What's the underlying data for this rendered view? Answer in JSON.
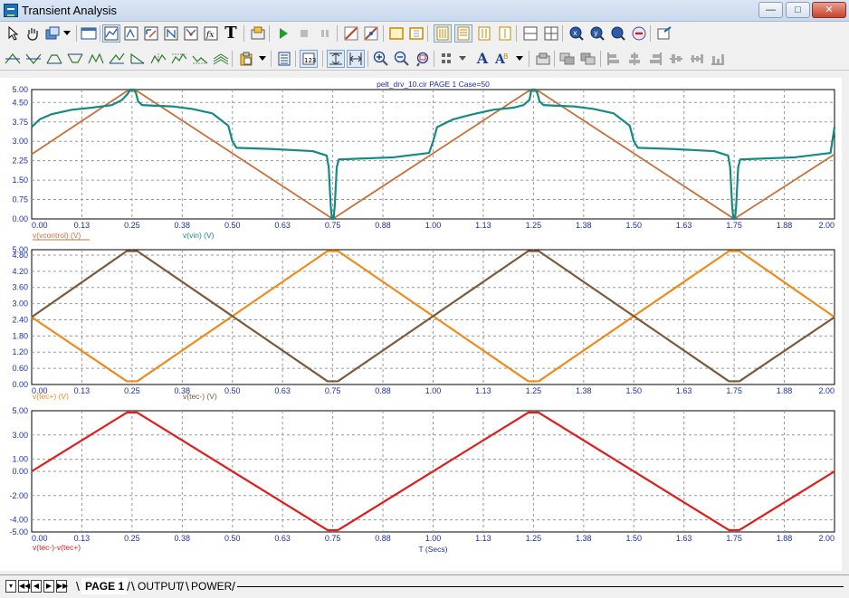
{
  "window": {
    "title": "Transient Analysis",
    "minimize_label": "—",
    "maximize_label": "□",
    "close_label": "✕"
  },
  "toolbar1": {
    "icons": [
      "select-arrow-icon",
      "pan-hand-icon",
      "properties-icon",
      "dropdown-arrow-icon",
      "window-icon",
      "graph-icon",
      "graph-scale-icon",
      "graph-zoom-icon",
      "graph-auto-icon",
      "graph-point-icon",
      "function-icon",
      "text-T-icon",
      "dialog-icon",
      "run-icon",
      "stop-icon",
      "pause-icon",
      "cursor-left-icon",
      "cursor-right-icon",
      "frame-icon",
      "frame-grid-icon",
      "page-layout-a-icon",
      "page-layout-b-icon",
      "page-layout-c-icon",
      "page-layout-d-icon",
      "split-horizontal-icon",
      "split-grid-icon",
      "search-x-icon",
      "search-y-icon",
      "search-fx-icon",
      "stop-circle-icon",
      "properties-check-icon"
    ]
  },
  "toolbar2": {
    "icons": [
      "peak-icon",
      "valley-icon",
      "high-icon",
      "low-icon",
      "inflection-icon",
      "slope-icon",
      "global-high-icon",
      "global-low-icon",
      "top-icon",
      "bottom-icon",
      "clipboard-icon",
      "dropdown-arrow-icon",
      "list-icon",
      "tokens-icon",
      "data-points-icon",
      "fit-icon",
      "zoom-in-icon",
      "zoom-out-icon",
      "zoom-window-icon",
      "grid-dots-icon",
      "font-A-icon",
      "font-AB-icon",
      "label-icon",
      "overlap-icon",
      "stack-icon",
      "align-left-icon",
      "align-center-icon",
      "align-right-icon",
      "align-top-icon",
      "align-bottom-icon"
    ],
    "fx_label": "fx",
    "t_label": "T",
    "a_label": "A"
  },
  "tabs": [
    {
      "label": "PAGE 1",
      "active": true
    },
    {
      "label": "OUTPUT",
      "active": false
    },
    {
      "label": "POWER",
      "active": false
    }
  ],
  "nav_buttons": [
    "▾",
    "◀◀",
    "◀",
    "▶",
    "▶▶"
  ],
  "chart_data": [
    {
      "type": "line",
      "title": "pelt_drv_10.cir PAGE 1 Case=50",
      "xlabel": "",
      "ylabel": "",
      "xlim": [
        0,
        2
      ],
      "ylim": [
        0,
        5
      ],
      "x_ticks": [
        "0.00",
        "0.13",
        "0.25",
        "0.38",
        "0.50",
        "0.63",
        "0.75",
        "0.88",
        "1.00",
        "1.13",
        "1.25",
        "1.38",
        "1.50",
        "1.63",
        "1.75",
        "1.88",
        "2.00"
      ],
      "y_ticks": [
        "0.00",
        "0.75",
        "1.50",
        "2.25",
        "3.00",
        "3.75",
        "4.50",
        "5.00"
      ],
      "grid": true,
      "series": [
        {
          "name": "v(vcontrol) (V)",
          "color": "#c8703a",
          "x": [
            0,
            0.237,
            0.263,
            0.75,
            1.237,
            1.263,
            1.75,
            2.0
          ],
          "y": [
            2.5,
            4.94,
            4.94,
            0.0,
            4.94,
            4.94,
            0.0,
            2.5
          ]
        },
        {
          "name": "v(vin) (V)",
          "color": "#158a84",
          "x": [
            0,
            0.02,
            0.05,
            0.1,
            0.15,
            0.2,
            0.225,
            0.24,
            0.245,
            0.25,
            0.255,
            0.26,
            0.265,
            0.275,
            0.3,
            0.35,
            0.4,
            0.45,
            0.49,
            0.5,
            0.51,
            0.6,
            0.7,
            0.735,
            0.74,
            0.745,
            0.748,
            0.752,
            0.755,
            0.76,
            0.765,
            0.8,
            0.9,
            0.99,
            1.0,
            1.01,
            1.05,
            1.1,
            1.15,
            1.2,
            1.225,
            1.24,
            1.245,
            1.25,
            1.255,
            1.26,
            1.265,
            1.275,
            1.3,
            1.35,
            1.4,
            1.45,
            1.49,
            1.5,
            1.51,
            1.6,
            1.7,
            1.735,
            1.74,
            1.745,
            1.748,
            1.752,
            1.755,
            1.76,
            1.765,
            1.8,
            1.9,
            1.99,
            2.0
          ],
          "y": [
            3.55,
            3.85,
            4.05,
            4.22,
            4.3,
            4.4,
            4.6,
            4.85,
            5.0,
            5.0,
            5.0,
            4.85,
            4.55,
            4.4,
            4.38,
            4.35,
            4.25,
            4.08,
            3.6,
            3.0,
            2.75,
            2.7,
            2.62,
            2.45,
            2.0,
            0.5,
            0.0,
            0.0,
            0.5,
            2.0,
            2.3,
            2.32,
            2.38,
            2.55,
            3.0,
            3.55,
            3.85,
            4.05,
            4.22,
            4.3,
            4.4,
            4.6,
            5.0,
            5.0,
            5.0,
            4.85,
            4.55,
            4.4,
            4.38,
            4.35,
            4.25,
            4.08,
            3.6,
            3.0,
            2.75,
            2.7,
            2.62,
            2.45,
            2.0,
            0.5,
            0.0,
            0.0,
            0.5,
            2.0,
            2.3,
            2.32,
            2.38,
            2.55,
            3.55
          ]
        }
      ]
    },
    {
      "type": "line",
      "title": "",
      "xlabel": "",
      "ylabel": "",
      "xlim": [
        0,
        2
      ],
      "ylim": [
        0,
        5
      ],
      "x_ticks": [
        "0.00",
        "0.13",
        "0.25",
        "0.38",
        "0.50",
        "0.63",
        "0.75",
        "0.88",
        "1.00",
        "1.13",
        "1.25",
        "1.38",
        "1.50",
        "1.63",
        "1.75",
        "1.88",
        "2.00"
      ],
      "y_ticks": [
        "0.00",
        "0.60",
        "1.20",
        "1.80",
        "2.40",
        "3.00",
        "3.60",
        "4.20",
        "4.80",
        "5.00"
      ],
      "grid": true,
      "series": [
        {
          "name": "v(tec+) (V)",
          "color": "#f08a1a",
          "x": [
            0,
            0.237,
            0.263,
            0.737,
            0.763,
            1.237,
            1.263,
            1.737,
            1.763,
            2.0
          ],
          "y": [
            2.5,
            0.12,
            0.12,
            4.95,
            4.95,
            0.12,
            0.12,
            4.95,
            4.95,
            2.5
          ]
        },
        {
          "name": "v(tec-) (V)",
          "color": "#7b5a3c",
          "x": [
            0,
            0.237,
            0.263,
            0.737,
            0.763,
            1.237,
            1.263,
            1.737,
            1.763,
            2.0
          ],
          "y": [
            2.5,
            4.95,
            4.95,
            0.12,
            0.12,
            4.95,
            4.95,
            0.12,
            0.12,
            2.5
          ]
        }
      ]
    },
    {
      "type": "line",
      "title": "",
      "xlabel": "T (Secs)",
      "ylabel": "",
      "xlim": [
        0,
        2
      ],
      "ylim": [
        -5,
        5
      ],
      "x_ticks": [
        "0.00",
        "0.13",
        "0.25",
        "0.38",
        "0.50",
        "0.63",
        "0.75",
        "0.88",
        "1.00",
        "1.13",
        "1.25",
        "1.38",
        "1.50",
        "1.63",
        "1.75",
        "1.88",
        "2.00"
      ],
      "y_ticks": [
        "-5.00",
        "-4.00",
        "-2.00",
        "0.00",
        "1.00",
        "3.00",
        "5.00"
      ],
      "grid": true,
      "series": [
        {
          "name": "v(tec-)-v(tec+)",
          "color": "#e21b1b",
          "x": [
            0,
            0.237,
            0.263,
            0.737,
            0.763,
            1.237,
            1.263,
            1.737,
            1.763,
            2.0
          ],
          "y": [
            0.0,
            4.85,
            4.85,
            -4.85,
            -4.85,
            4.85,
            4.85,
            -4.85,
            -4.85,
            0.0
          ]
        }
      ]
    }
  ]
}
